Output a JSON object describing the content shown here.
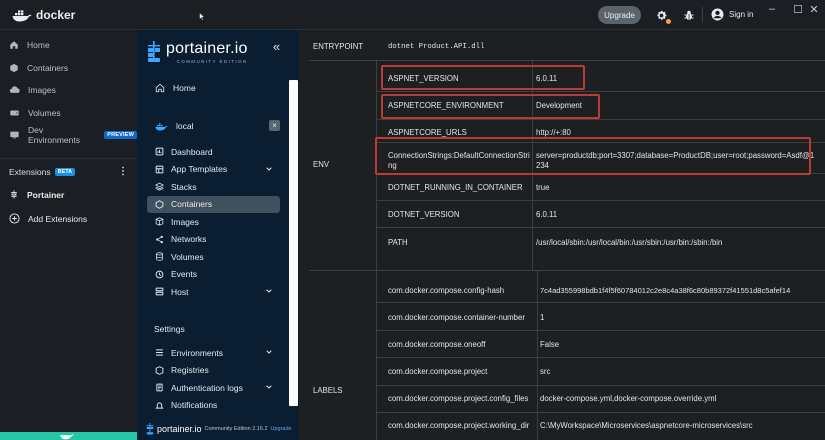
{
  "titlebar": {
    "app_name": "docker",
    "upgrade_label": "Upgrade",
    "signin_label": "Sign in",
    "window_controls": [
      "–",
      "☐",
      "✕"
    ]
  },
  "docker_sidebar": {
    "items": [
      {
        "label": "Home",
        "icon": "home-icon"
      },
      {
        "label": "Containers",
        "icon": "containers-icon"
      },
      {
        "label": "Images",
        "icon": "images-icon"
      },
      {
        "label": "Volumes",
        "icon": "volumes-icon"
      },
      {
        "label": "Dev Environments",
        "icon": "dev-environments-icon",
        "badge": "PREVIEW"
      }
    ],
    "extensions": {
      "label": "Extensions",
      "badge": "BETA",
      "items": [
        {
          "label": "Portainer",
          "icon": "portainer-icon"
        },
        {
          "label": "Add Extensions",
          "icon": "plus-circle-icon"
        }
      ]
    }
  },
  "portainer_sidebar": {
    "logo_name": "portainer.io",
    "logo_sub": "COMMUNITY EDITION",
    "home_label": "Home",
    "environment": "local",
    "env_items": [
      {
        "label": "Dashboard",
        "icon": "dashboard-icon"
      },
      {
        "label": "App Templates",
        "icon": "app-templates-icon",
        "expandable": true
      },
      {
        "label": "Stacks",
        "icon": "stacks-icon"
      },
      {
        "label": "Containers",
        "icon": "containers-icon",
        "active": true
      },
      {
        "label": "Images",
        "icon": "images-icon"
      },
      {
        "label": "Networks",
        "icon": "networks-icon"
      },
      {
        "label": "Volumes",
        "icon": "volumes-icon"
      },
      {
        "label": "Events",
        "icon": "events-icon"
      },
      {
        "label": "Host",
        "icon": "host-icon",
        "expandable": true
      }
    ],
    "settings_label": "Settings",
    "settings_items": [
      {
        "label": "Environments",
        "icon": "environments-icon",
        "expandable": true
      },
      {
        "label": "Registries",
        "icon": "registries-icon"
      },
      {
        "label": "Authentication logs",
        "icon": "auth-logs-icon",
        "expandable": true
      },
      {
        "label": "Notifications",
        "icon": "notifications-icon"
      }
    ],
    "footer": {
      "name": "portainer.io",
      "edition": "Community Edition 2.16.2",
      "upgrade": "Upgrade"
    }
  },
  "details": {
    "entrypoint_label": "ENTRYPOINT",
    "entrypoint_value": "dotnet Product.API.dll",
    "env_label": "ENV",
    "env": [
      {
        "key": "ASPNET_VERSION",
        "value": "6.0.11",
        "highlighted": true
      },
      {
        "key": "ASPNETCORE_ENVIRONMENT",
        "value": "Development",
        "highlighted": true
      },
      {
        "key": "ASPNETCORE_URLS",
        "value": "http://+:80"
      },
      {
        "key": "ConnectionStrings:DefaultConnectionString",
        "key_wrap": [
          "ConnectionStrings:DefaultConnectionStri",
          "ng"
        ],
        "value_wrap": [
          "server=productdb;port=3307;database=ProductDB;user=root;password=Asdf@1",
          "234"
        ],
        "highlighted": true
      },
      {
        "key": "DOTNET_RUNNING_IN_CONTAINER",
        "value": "true"
      },
      {
        "key": "DOTNET_VERSION",
        "value": "6.0.11"
      },
      {
        "key": "PATH",
        "value": "/usr/local/sbin:/usr/local/bin:/usr/sbin:/usr/bin:/sbin:/bin"
      }
    ],
    "labels_label": "LABELS",
    "labels": [
      {
        "key": "com.docker.compose.config-hash",
        "value": "7c4ad355998bdb1f4f5f60784012c2e8c4a38f6c80b89372f41551d8c5afef14"
      },
      {
        "key": "com.docker.compose.container-number",
        "value": "1"
      },
      {
        "key": "com.docker.compose.oneoff",
        "value": "False"
      },
      {
        "key": "com.docker.compose.project",
        "value": "src"
      },
      {
        "key": "com.docker.compose.project.config_files",
        "value": "docker-compose.yml,docker-compose.override.yml"
      },
      {
        "key": "com.docker.compose.project.working_dir",
        "value": "C:\\MyWorkspace\\Microservices\\aspnetcore-microservices\\src"
      }
    ]
  },
  "colors": {
    "highlight": "#b83a3a",
    "portainer_bg": "#0b1d31",
    "docker_accent": "#27c6a6"
  }
}
